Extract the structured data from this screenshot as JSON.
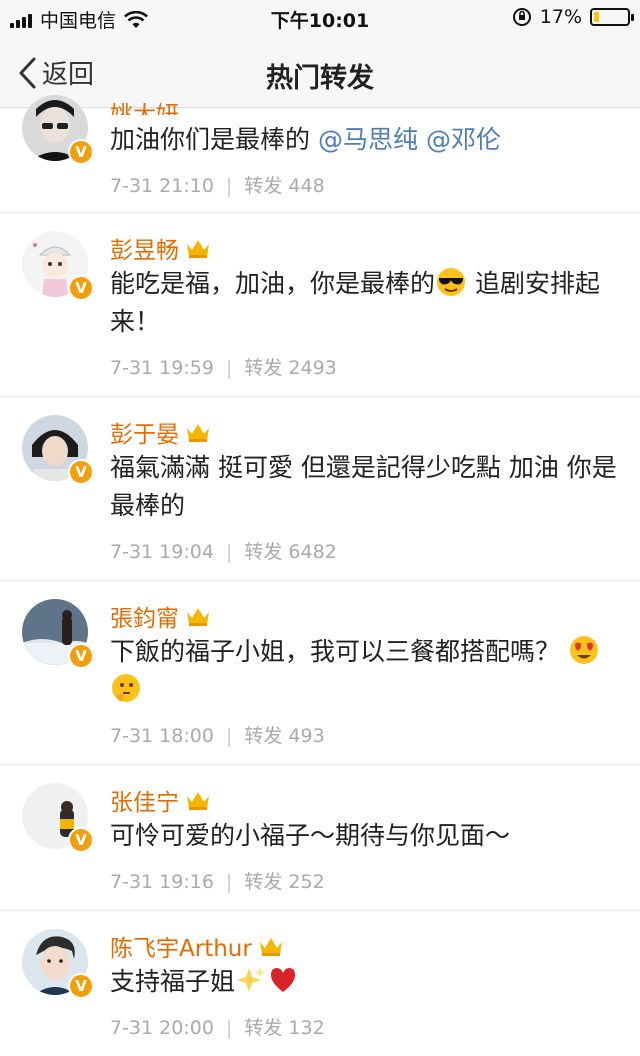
{
  "status_bar": {
    "carrier": "中国电信",
    "time": "下午10:01",
    "battery": "17%",
    "battery_level": 0.17
  },
  "nav": {
    "back_label": "返回",
    "title": "热门转发"
  },
  "items": [
    {
      "name": "姚大妍",
      "text_plain": "加油你们是最棒的",
      "mentions": [
        "@马思纯",
        "@邓伦"
      ],
      "date": "7-31 21:10",
      "repost_label": "转发",
      "repost_count": "448"
    },
    {
      "name": "彭昱畅",
      "text_a": "能吃是福，加油，你是最棒的",
      "text_b": " 追剧安排起来！",
      "emoji": "sunglasses-emoji",
      "date": "7-31 19:59",
      "repost_label": "转发",
      "repost_count": "2493"
    },
    {
      "name": "彭于晏",
      "text": "福氣滿滿 挺可愛 但還是記得少吃點 加油 你是最棒的",
      "date": "7-31 19:04",
      "repost_label": "转发",
      "repost_count": "6482"
    },
    {
      "name": "張鈞甯",
      "text": "下飯的福子小姐，我可以三餐都搭配嗎？",
      "emoji": [
        "heart-eyes-emoji",
        "thinking-emoji"
      ],
      "date": "7-31 18:00",
      "repost_label": "转发",
      "repost_count": "493"
    },
    {
      "name": "张佳宁",
      "text": "可怜可爱的小福子～期待与你见面～",
      "date": "7-31 19:16",
      "repost_label": "转发",
      "repost_count": "252"
    },
    {
      "name": "陈飞宇Arthur",
      "text": "支持福子姐",
      "emoji": [
        "sparkles-emoji",
        "red-heart-emoji"
      ],
      "date": "7-31 20:00",
      "repost_label": "转发",
      "repost_count": "132"
    }
  ],
  "colors": {
    "username": "#e36b00",
    "mention": "#4d7eb8",
    "badge": "#f49e0b",
    "meta": "#aaaaaa"
  }
}
